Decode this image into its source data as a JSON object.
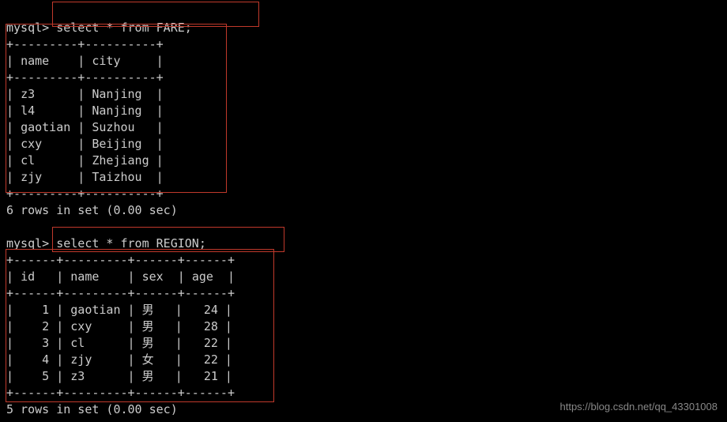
{
  "queries": [
    {
      "prompt": "mysql>",
      "sql": "select * from FARE;",
      "columns": [
        "name",
        "city"
      ],
      "rows": [
        [
          "z3",
          "Nanjing"
        ],
        [
          "l4",
          "Nanjing"
        ],
        [
          "gaotian",
          "Suzhou"
        ],
        [
          "cxy",
          "Beijing"
        ],
        [
          "cl",
          "Zhejiang"
        ],
        [
          "zjy",
          "Taizhou"
        ]
      ],
      "footer": "6 rows in set (0.00 sec)"
    },
    {
      "prompt": "mysql>",
      "sql": "select * from REGION;",
      "columns": [
        "id",
        "name",
        "sex",
        "age"
      ],
      "rows": [
        [
          "1",
          "gaotian",
          "男",
          "24"
        ],
        [
          "2",
          "cxy",
          "男",
          "28"
        ],
        [
          "3",
          "cl",
          "男",
          "22"
        ],
        [
          "4",
          "zjy",
          "女",
          "22"
        ],
        [
          "5",
          "z3",
          "男",
          "21"
        ]
      ],
      "footer": "5 rows in set (0.00 sec)"
    }
  ],
  "watermark": "https://blog.csdn.net/qq_43301008",
  "chart_data": [
    {
      "type": "table",
      "title": "FARE",
      "columns": [
        "name",
        "city"
      ],
      "rows": [
        [
          "z3",
          "Nanjing"
        ],
        [
          "l4",
          "Nanjing"
        ],
        [
          "gaotian",
          "Suzhou"
        ],
        [
          "cxy",
          "Beijing"
        ],
        [
          "cl",
          "Zhejiang"
        ],
        [
          "zjy",
          "Taizhou"
        ]
      ]
    },
    {
      "type": "table",
      "title": "REGION",
      "columns": [
        "id",
        "name",
        "sex",
        "age"
      ],
      "rows": [
        [
          1,
          "gaotian",
          "男",
          24
        ],
        [
          2,
          "cxy",
          "男",
          28
        ],
        [
          3,
          "cl",
          "男",
          22
        ],
        [
          4,
          "zjy",
          "女",
          22
        ],
        [
          5,
          "z3",
          "男",
          21
        ]
      ]
    }
  ]
}
